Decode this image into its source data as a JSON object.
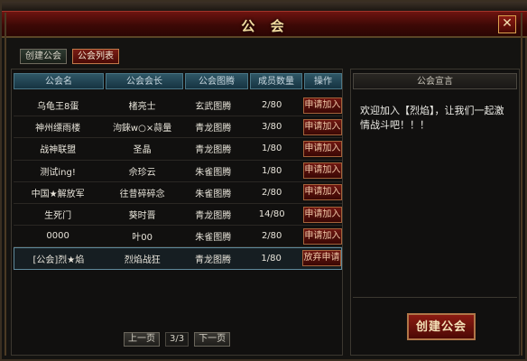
{
  "window": {
    "title": "公 会",
    "close_glyph": "✕"
  },
  "tabs": [
    {
      "label": "创建公会",
      "active": false
    },
    {
      "label": "公会列表",
      "active": true
    }
  ],
  "table": {
    "headers": [
      "公会名",
      "公会会长",
      "公会图腾",
      "成员数量",
      "操作"
    ],
    "rows": [
      {
        "name": "乌龟王8蛋",
        "leader": "楮亮士",
        "totem": "玄武图腾",
        "members": "2/80",
        "action": "申请加入",
        "selected": false
      },
      {
        "name": "神州缥雨楼",
        "leader": "泃錸w○×蒜量",
        "totem": "青龙图腾",
        "members": "3/80",
        "action": "申请加入",
        "selected": false
      },
      {
        "name": "战神联盟",
        "leader": "圣晶",
        "totem": "青龙图腾",
        "members": "1/80",
        "action": "申请加入",
        "selected": false
      },
      {
        "name": "测试ing!",
        "leader": "佘珍云",
        "totem": "朱雀图腾",
        "members": "1/80",
        "action": "申请加入",
        "selected": false
      },
      {
        "name": "中国★解放军",
        "leader": "往昔碎碎念",
        "totem": "朱雀图腾",
        "members": "2/80",
        "action": "申请加入",
        "selected": false
      },
      {
        "name": "生死门",
        "leader": "葵时晋",
        "totem": "青龙图腾",
        "members": "14/80",
        "action": "申请加入",
        "selected": false
      },
      {
        "name": "0000",
        "leader": "叶00",
        "totem": "朱雀图腾",
        "members": "2/80",
        "action": "申请加入",
        "selected": false
      },
      {
        "name": "[公会]烈★焰",
        "leader": "烈焰战狂",
        "totem": "青龙图腾",
        "members": "1/80",
        "action": "放弃申请",
        "selected": true
      }
    ]
  },
  "pager": {
    "prev_label": "上一页",
    "page_info": "3/3",
    "next_label": "下一页"
  },
  "announcement": {
    "header": "公会宣言",
    "text": "欢迎加入【烈焰】，让我们一起激情战斗吧！！！"
  },
  "create_button_label": "创建公会",
  "colors": {
    "title_red": "#6e1410",
    "button_red": "#6e1610",
    "header_teal": "#2f5766",
    "gold_text": "#f2dca0"
  }
}
